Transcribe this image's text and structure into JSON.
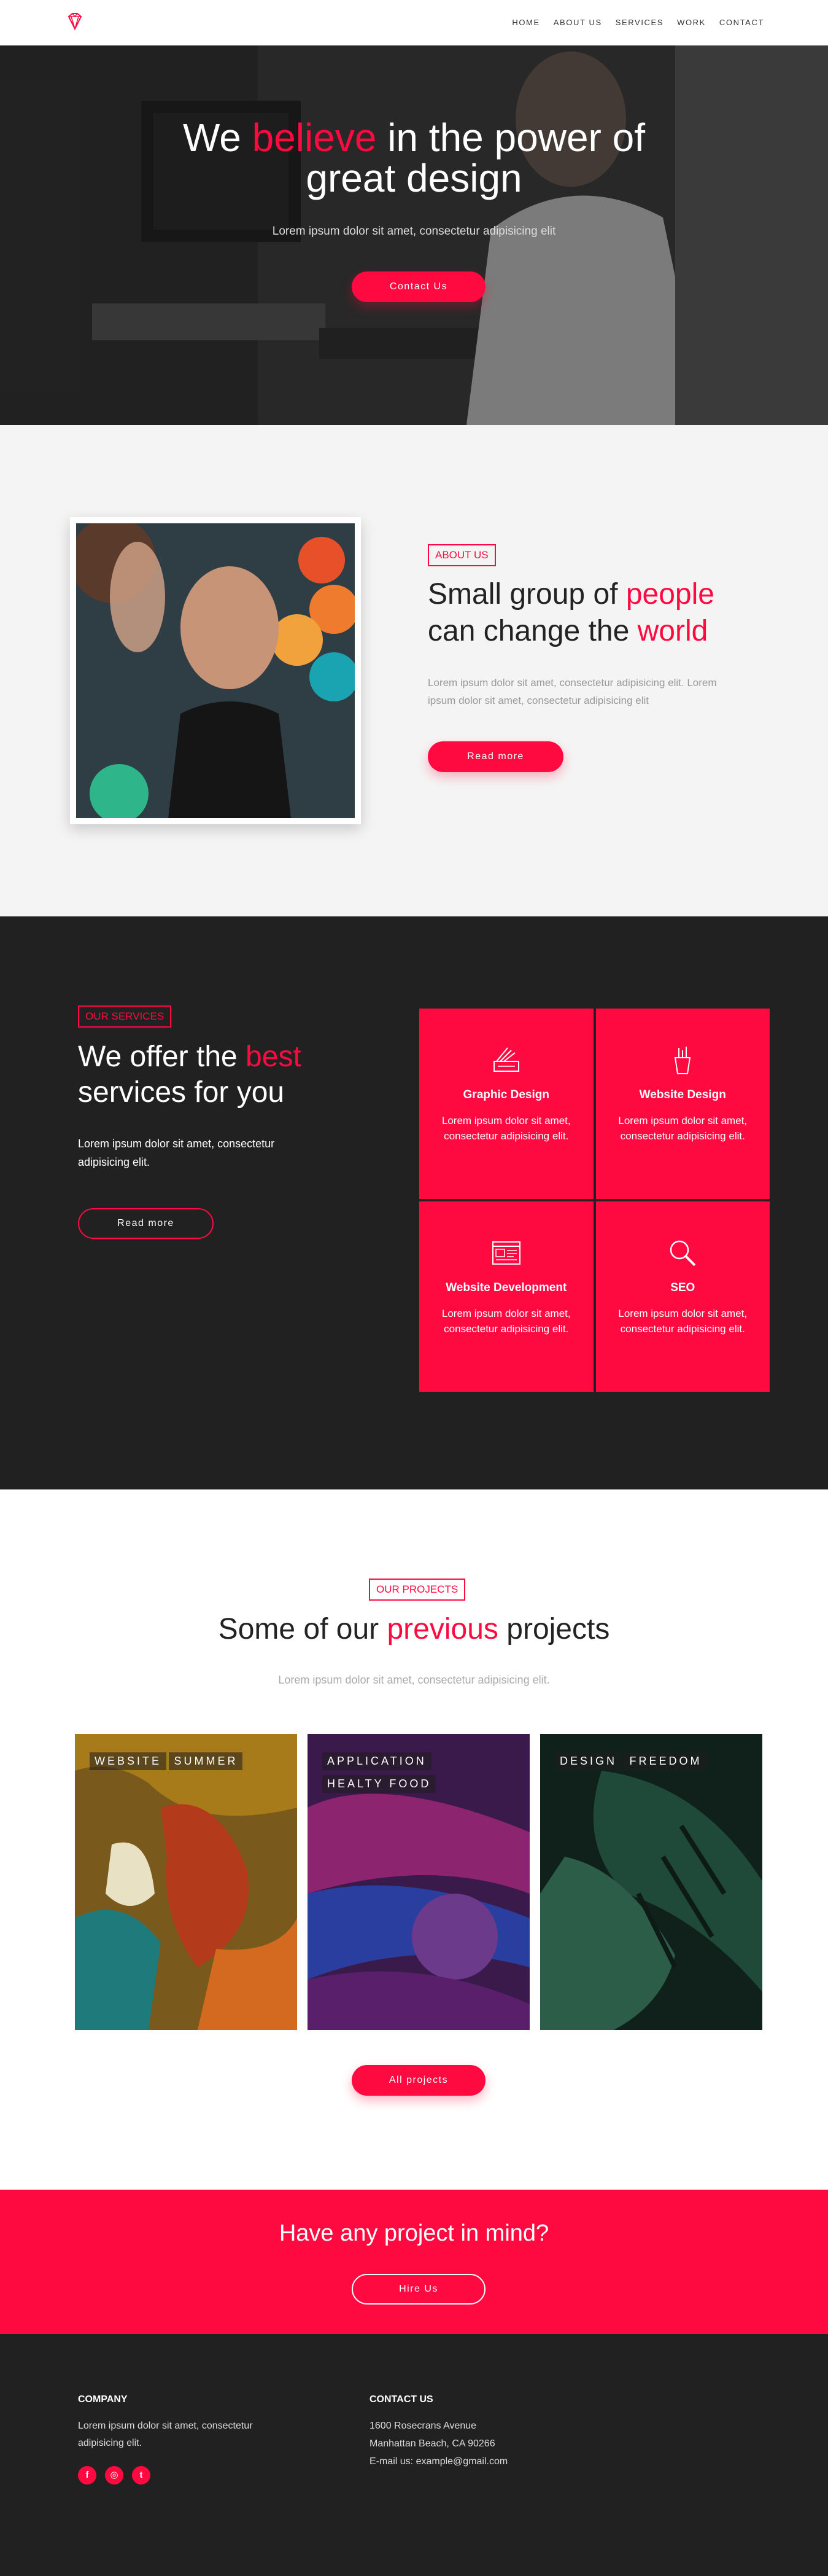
{
  "nav": {
    "logo_icon": "diamond-logo",
    "links": [
      "HOME",
      "ABOUT US",
      "SERVICES",
      "WORK",
      "CONTACT"
    ]
  },
  "hero": {
    "title_part1": "We ",
    "title_accent": "believe",
    "title_part2": " in the power of",
    "title_line2": "great design",
    "subtitle": "Lorem ipsum dolor sit amet, consectetur adipisicing elit",
    "button": "Contact Us"
  },
  "about": {
    "tag": "ABOUT US",
    "title_p1": "Small group of ",
    "title_accent1": "people",
    "title_p2": "can change the ",
    "title_accent2": "world",
    "text": "Lorem ipsum dolor sit amet, consectetur adipisicing elit. Lorem ipsum dolor sit amet, consectetur adipisicing elit",
    "button": "Read more"
  },
  "services": {
    "tag": "OUR SERVICES",
    "title_p1": "We offer the ",
    "title_accent": "best",
    "title_p2": "services for you",
    "text": "Lorem ipsum dolor sit amet, consectetur adipisicing elit.",
    "button": "Read more",
    "cards": [
      {
        "icon": "palette-icon",
        "title": "Graphic Design",
        "desc": "Lorem ipsum dolor sit amet, consectetur adipisicing elit."
      },
      {
        "icon": "pencil-cup-icon",
        "title": "Website Design",
        "desc": "Lorem ipsum dolor sit amet, consectetur adipisicing elit."
      },
      {
        "icon": "website-layout-icon",
        "title": "Website Development",
        "desc": "Lorem ipsum dolor sit amet, consectetur adipisicing elit."
      },
      {
        "icon": "magnifier-icon",
        "title": "SEO",
        "desc": "Lorem ipsum dolor sit amet, consectetur adipisicing elit."
      }
    ]
  },
  "projects": {
    "tag": "OUR PROJECTS",
    "title_p1": "Some of our ",
    "title_accent": "previous",
    "title_p2": " projects",
    "subtitle": "Lorem ipsum dolor sit amet, consectetur adipisicing elit.",
    "items": [
      {
        "label1": "WEBSITE",
        "label2": "SUMMER"
      },
      {
        "label1": "APPLICATION",
        "label2": "HEALTY FOOD"
      },
      {
        "label1": "DESIGN",
        "label2": "FREEDOM"
      }
    ],
    "button": "All projects"
  },
  "cta": {
    "title": "Have any project in mind?",
    "button": "Hire Us"
  },
  "footer": {
    "company_heading": "COMPANY",
    "company_text": "Lorem ipsum dolor sit amet, consectetur adipisicing elit.",
    "social": [
      {
        "icon": "facebook-icon",
        "glyph": "f"
      },
      {
        "icon": "instagram-icon",
        "glyph": "◎"
      },
      {
        "icon": "twitter-icon",
        "glyph": "t"
      }
    ],
    "contact_heading": "CONTACT US",
    "address1": "1600 Rosecrans Avenue",
    "address2": "Manhattan Beach, CA 90266",
    "email": "E-mail us: example@gmail.com"
  },
  "colors": {
    "accent": "#ff0a40",
    "dark": "#212121",
    "light": "#f4f4f4"
  }
}
